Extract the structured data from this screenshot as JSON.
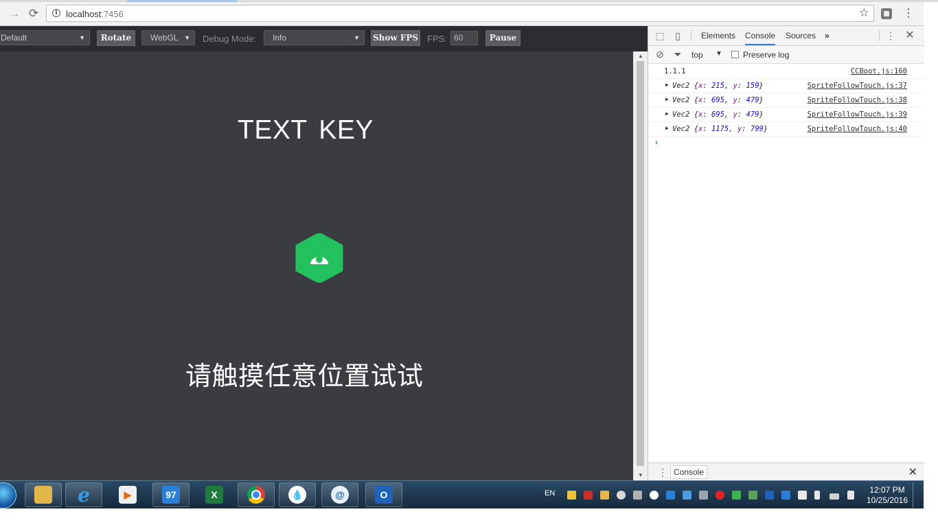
{
  "browser": {
    "url_host": "localhost",
    "url_port": ":7456",
    "back_icon": "arrow-left-icon",
    "forward_icon": "arrow-right-icon",
    "reload_icon": "reload-icon"
  },
  "toolbar": {
    "device_select": "Default",
    "rotate_label": "Rotate",
    "renderer_select": "WebGL",
    "debug_mode_label": "Debug Mode:",
    "debug_mode_select": "Info",
    "show_fps_label": "Show FPS",
    "fps_label": "FPS:",
    "fps_value": "60",
    "pause_label": "Pause"
  },
  "game": {
    "title": "TEXT  KEY",
    "hint": "请触摸任意位置试试",
    "sprite_color": "#22c15e",
    "background_color": "#3a3c40"
  },
  "devtools": {
    "tabs": [
      "Elements",
      "Console",
      "Sources"
    ],
    "active_tab": "Console",
    "more_tabs": "»",
    "context": "top",
    "preserve_log": "Preserve log",
    "logs": [
      {
        "text": "1.1.1",
        "source": "CCBoot.js:160"
      },
      {
        "type": "Vec2",
        "x": "215",
        "y": "159",
        "source": "SpriteFollowTouch.js:37"
      },
      {
        "type": "Vec2",
        "x": "695",
        "y": "479",
        "source": "SpriteFollowTouch.js:38"
      },
      {
        "type": "Vec2",
        "x": "695",
        "y": "479",
        "source": "SpriteFollowTouch.js:39"
      },
      {
        "type": "Vec2",
        "x": "1175",
        "y": "799",
        "source": "SpriteFollowTouch.js:40"
      }
    ],
    "drawer_tab": "Console"
  },
  "taskbar": {
    "language": "EN",
    "time": "12:07 PM",
    "date": "10/25/2016"
  }
}
